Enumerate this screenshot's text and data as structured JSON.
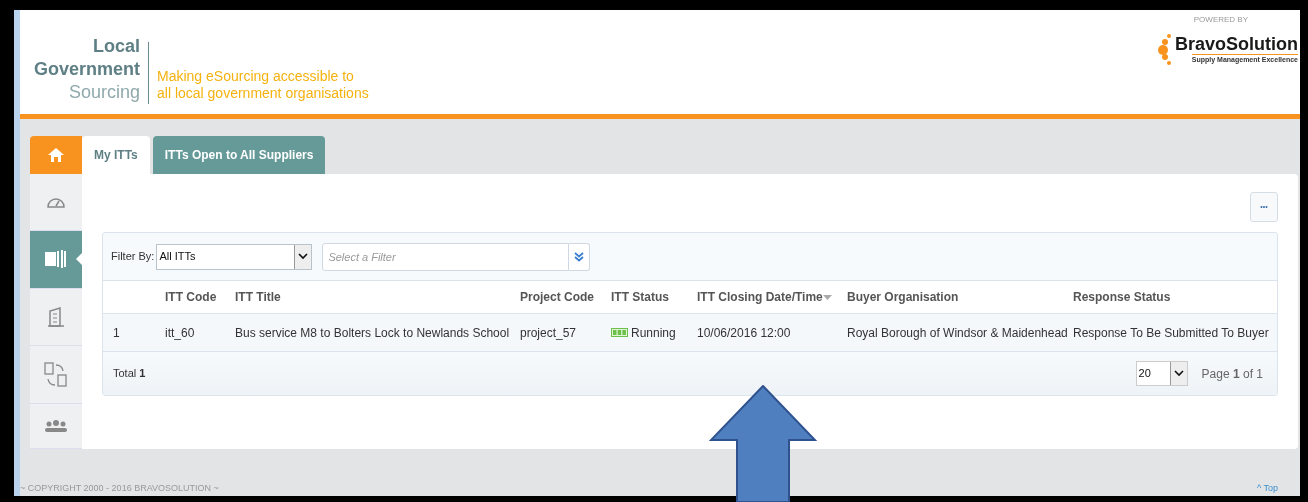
{
  "header": {
    "logo_lines": [
      "Local",
      "Government",
      "Sourcing"
    ],
    "tagline": [
      "Making eSourcing accessible to",
      "all local government organisations"
    ],
    "powered_by": "POWERED BY",
    "brand": "BravoSolution",
    "brand_tagline": "Supply Management Excellence"
  },
  "tabs": [
    {
      "kind": "home",
      "selected": false
    },
    {
      "kind": "text",
      "label": "My ITTs",
      "selected": true
    },
    {
      "kind": "text",
      "label": "ITTs Open to All Suppliers",
      "selected": false
    }
  ],
  "sidebar": {
    "items": [
      {
        "kind": "gauge",
        "selected": false
      },
      {
        "kind": "document",
        "selected": true
      },
      {
        "kind": "building",
        "selected": false
      },
      {
        "kind": "exchange",
        "selected": false
      },
      {
        "kind": "people",
        "selected": false
      }
    ]
  },
  "more_button": "•••",
  "filter": {
    "label": "Filter By:",
    "value": "All ITTs",
    "placeholder": "Select a Filter"
  },
  "table": {
    "columns": [
      "",
      "ITT Code",
      "ITT Title",
      "Project Code",
      "ITT Status",
      "ITT Closing Date/Time",
      "Buyer Organisation",
      "Response Status"
    ],
    "rows": [
      [
        "1",
        "itt_60",
        "Bus service M8 to Bolters Lock to Newlands School",
        "project_57",
        "Running",
        "10/06/2016 12:00",
        "Royal Borough of Windsor & Maidenhead",
        "Response To Be Submitted To Buyer"
      ]
    ],
    "total": "Total **1**",
    "page_size": "20",
    "page": "Page **1** of 1"
  },
  "footer": {
    "copyright": "~ COPYRIGHT 2000 - 2016 BRAVOSOLUTION ~",
    "top_link": "^ Top"
  }
}
